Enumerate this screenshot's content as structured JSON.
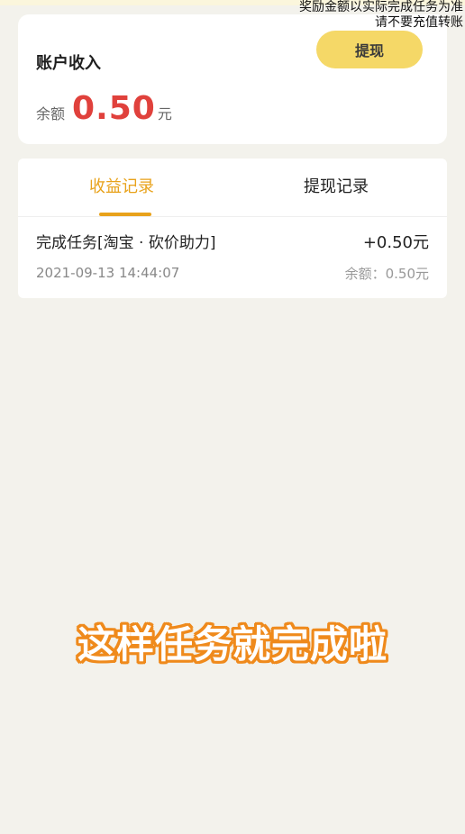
{
  "notice": {
    "line1": "奖励金额以实际完成任务为准",
    "line2": "请不要充值转账"
  },
  "account": {
    "title": "账户收入",
    "withdraw_button": "提现",
    "balance_label": "余额",
    "balance_value": "0.50",
    "balance_unit": "元"
  },
  "tabs": {
    "income_label": "收益记录",
    "withdraw_label": "提现记录",
    "active": "收益记录",
    "accent_color": "#e8a21b"
  },
  "records": [
    {
      "title": "完成任务[淘宝 · 砍价助力]",
      "time": "2021-09-13 14:44:07",
      "amount": "+0.50元",
      "balance": "余额：0.50元"
    }
  ],
  "caption": {
    "text": "这样任务就完成啦",
    "outline_color": "#ef8a1c"
  },
  "colors": {
    "balance_value": "#e0413c",
    "withdraw_button": "#f5d867",
    "background": "#f3f2ec"
  }
}
